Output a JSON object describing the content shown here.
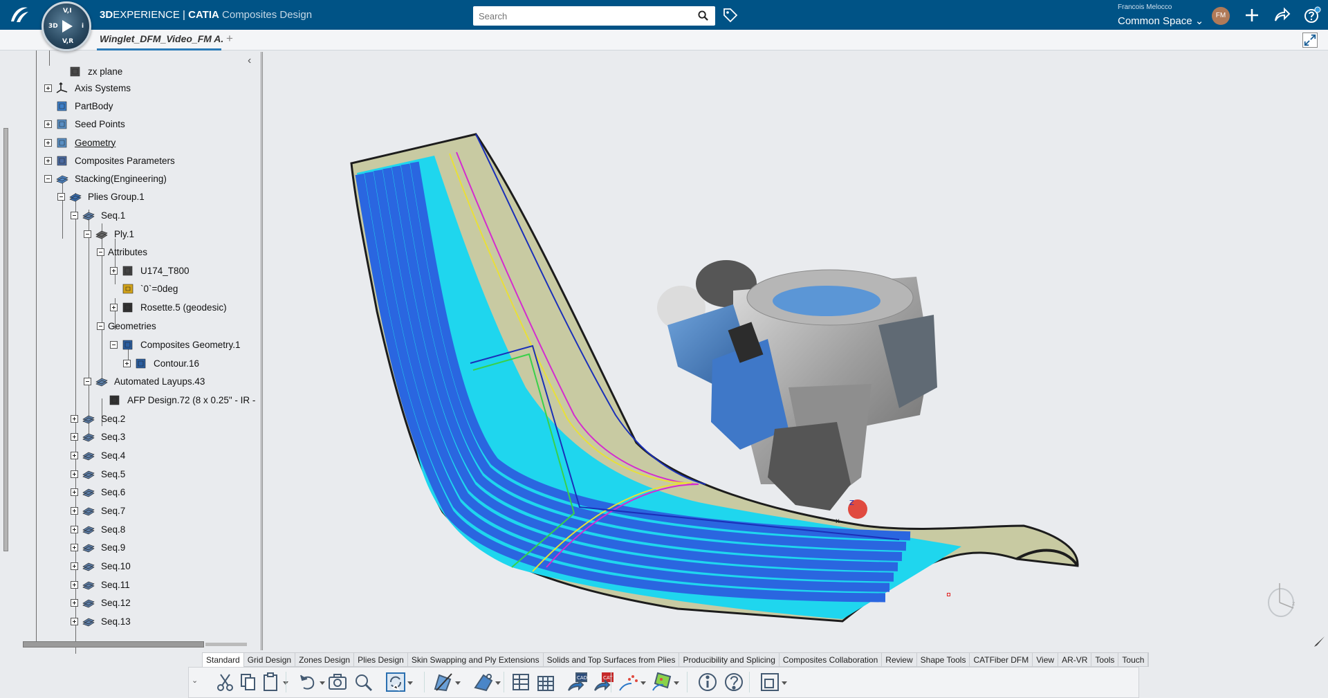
{
  "topbar": {
    "brand_bold": "3D",
    "brand_rest": "EXPERIENCE | ",
    "brand_catia": "CATIA",
    "app_name": "Composites Design",
    "search_placeholder": "Search",
    "user_name": "Francois Melocco",
    "space": "Common Space ⌄",
    "avatar_initials": "FM",
    "compass_labels": {
      "north": "V,I",
      "west": "3D",
      "east": "i",
      "south": "V,R"
    }
  },
  "tabs": {
    "document": "Winglet_DFM_Video_FM A.",
    "add": "+"
  },
  "tree": {
    "collapse": "‹",
    "items": [
      {
        "label": "zx plane",
        "icon": "plane-icon"
      },
      {
        "label": "Axis Systems",
        "icon": "axis-icon"
      },
      {
        "label": "PartBody",
        "icon": "partbody-icon"
      },
      {
        "label": "Seed Points",
        "icon": "geometry-icon"
      },
      {
        "label": "Geometry",
        "icon": "geometry-icon"
      },
      {
        "label": "Composites Parameters",
        "icon": "parameters-icon"
      },
      {
        "label": "Stacking(Engineering)",
        "icon": "stacking-icon"
      },
      {
        "label": "Plies Group.1",
        "icon": "plies-group-icon"
      },
      {
        "label": "Seq.1",
        "icon": "sequence-icon"
      },
      {
        "label": "Ply.1",
        "icon": "ply-icon"
      },
      {
        "label": "Attributes",
        "icon": ""
      },
      {
        "label": "U174_T800",
        "icon": "material-icon"
      },
      {
        "label": "`0`=0deg",
        "icon": "direction-icon"
      },
      {
        "label": "Rosette.5 (geodesic)",
        "icon": "rosette-icon"
      },
      {
        "label": "Geometries",
        "icon": ""
      },
      {
        "label": "Composites Geometry.1",
        "icon": "composites-geometry-icon"
      },
      {
        "label": "Contour.16",
        "icon": "contour-icon"
      },
      {
        "label": "Automated Layups.43",
        "icon": "layup-icon"
      },
      {
        "label": "AFP Design.72 (8 x 0.25\" - IR -",
        "icon": "afp-design-icon"
      },
      {
        "label": "Seq.2",
        "icon": "sequence-icon"
      },
      {
        "label": "Seq.3",
        "icon": "sequence-icon"
      },
      {
        "label": "Seq.4",
        "icon": "sequence-icon"
      },
      {
        "label": "Seq.5",
        "icon": "sequence-icon"
      },
      {
        "label": "Seq.6",
        "icon": "sequence-icon"
      },
      {
        "label": "Seq.7",
        "icon": "sequence-icon"
      },
      {
        "label": "Seq.8",
        "icon": "sequence-icon"
      },
      {
        "label": "Seq.9",
        "icon": "sequence-icon"
      },
      {
        "label": "Seq.10",
        "icon": "sequence-icon"
      },
      {
        "label": "Seq.11",
        "icon": "sequence-icon"
      },
      {
        "label": "Seq.12",
        "icon": "sequence-icon"
      },
      {
        "label": "Seq.13",
        "icon": "sequence-icon"
      }
    ]
  },
  "action_bar": {
    "tabs": [
      "Standard",
      "Grid Design",
      "Zones Design",
      "Plies Design",
      "Skin Swapping and Ply Extensions",
      "Solids and Top Surfaces from Plies",
      "Producibility and Splicing",
      "Composites Collaboration",
      "Review",
      "Shape Tools",
      "CATFiber DFM",
      "View",
      "AR-VR",
      "Tools",
      "Touch"
    ],
    "active": "Standard",
    "collapse": "⌄",
    "tool_icons": [
      "cut-icon",
      "copy-icon",
      "paste-icon",
      "undo-icon",
      "capture-icon",
      "search-tool-icon",
      "update-icon",
      "sketch-icon",
      "shape-icon",
      "table-icon",
      "grid-icon",
      "export-cad-icon",
      "export-catfiber-icon",
      "scatter-icon",
      "mapping-icon",
      "info-icon",
      "help-icon",
      "window-icon"
    ],
    "cad_label": "CAD",
    "catfiber_label": "CAT"
  },
  "viewport": {
    "triad_z": "z",
    "robot_axis_z": "Z",
    "robot_axis_x": "x"
  },
  "colors": {
    "topbar": "#005386",
    "fiber_blue": "#2a66e0",
    "fiber_cyan": "#16e4f2",
    "surface": "#c7c9a0",
    "active_tab": "#ffffff"
  }
}
